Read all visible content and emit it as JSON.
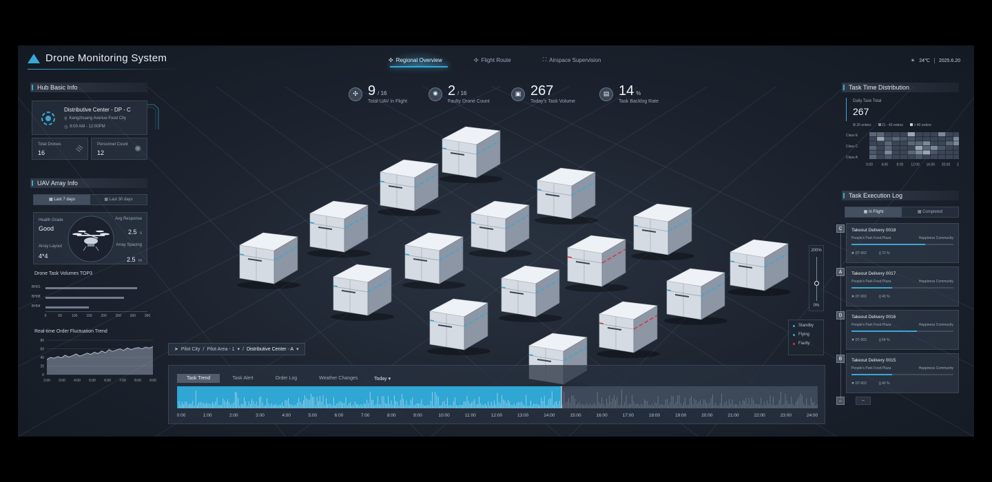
{
  "header": {
    "title": "Drone Monitoring System",
    "nav": [
      {
        "label": "Regional Overview",
        "icon": "drone-icon",
        "active": true
      },
      {
        "label": "Flight Route",
        "icon": "route-icon",
        "active": false
      },
      {
        "label": "Airspace Supervision",
        "icon": "airspace-icon",
        "active": false
      }
    ],
    "temperature": "24℃",
    "date": "2025.6.20"
  },
  "hub_info": {
    "title": "Hub Basic Info",
    "name": "Distributive Center - DP - C",
    "address": "Kangzhuang Avenue Food City",
    "hours": "8:00 AM - 12:00PM",
    "total_drones_label": "Total Drones",
    "total_drones": "16",
    "personnel_label": "Personnel Count",
    "personnel": "12"
  },
  "uav_array": {
    "title": "UAV Array Info",
    "range_tabs": [
      "Last 7 days",
      "Last 30 days"
    ],
    "health_label": "Health Grade",
    "health": "Good",
    "avg_response_label": "Avg Response",
    "avg_response": "2.5",
    "avg_response_unit": "s",
    "layout_label": "Array Layout",
    "layout": "4*4",
    "spacing_label": "Array Spacing",
    "spacing": "2.5",
    "spacing_unit": "m"
  },
  "top3": {
    "title": "Drone Task Volumes TOP3",
    "rows": [
      {
        "label": "BH01",
        "value": 315
      },
      {
        "label": "BH08",
        "value": 270
      },
      {
        "label": "BH04",
        "value": 150
      }
    ],
    "ticks": [
      "0",
      "50",
      "100",
      "150",
      "200",
      "250",
      "300",
      "350"
    ]
  },
  "trend": {
    "title": "Real-time Order Fluctuation Trend",
    "y_ticks": [
      "0",
      "20",
      "40",
      "60",
      "80"
    ],
    "x_ticks": [
      "2:00",
      "3:00",
      "4:00",
      "5:00",
      "6:00",
      "7:00",
      "8:00",
      "9:00"
    ],
    "values": [
      35,
      40,
      38,
      42,
      39,
      45,
      41,
      44,
      48,
      43,
      46,
      50,
      47,
      52,
      49,
      55,
      51,
      58,
      54,
      57,
      60,
      56,
      62,
      58,
      61,
      63,
      60,
      64,
      62,
      65
    ]
  },
  "stats": [
    {
      "value": "9",
      "total": "16",
      "label": "Total UAV in Flight",
      "icon": "drone-icon"
    },
    {
      "value": "2",
      "total": "16",
      "label": "Faulty Drone Count",
      "icon": "fan-icon"
    },
    {
      "value": "267",
      "total": "",
      "label": "Today's Task Volume",
      "icon": "package-icon"
    },
    {
      "value": "14",
      "total": "%",
      "label": "Task Backlog Rate",
      "icon": "stack-icon"
    }
  ],
  "task_time": {
    "title": "Task Time Distribution",
    "total_label": "Daily Task Total",
    "total": "267",
    "legend": [
      "20 orders",
      "21 - 40 orders",
      "> 40 orders"
    ],
    "rows": [
      "Class E",
      "Class C",
      "Class A"
    ],
    "x_ticks": [
      "0:00",
      "4:00",
      "8:00",
      "12:00",
      "16:00",
      "20:00",
      "24:00"
    ]
  },
  "exec_log": {
    "title": "Task Execution Log",
    "tabs": [
      "In Flight",
      "Completed"
    ],
    "items": [
      {
        "letter": "C",
        "title": "Takeout Delivery 0018",
        "from": "People's Park Food Plaza",
        "to": "Happiness Community",
        "drone": "DT-002",
        "battery": "72 %",
        "progress": 0.72
      },
      {
        "letter": "A",
        "title": "Takeout Delivery 0017",
        "from": "People's Park Food Plaza",
        "to": "Happiness Community",
        "drone": "DT-002",
        "battery": "40 %",
        "progress": 0.4
      },
      {
        "letter": "D",
        "title": "Takeout Delivery 0016",
        "from": "People's Park Food Plaza",
        "to": "Happiness Community",
        "drone": "DT-002",
        "battery": "64 %",
        "progress": 0.64
      },
      {
        "letter": "B",
        "title": "Takeout Delivery 0015",
        "from": "People's Park Food Plaza",
        "to": "Happiness Community",
        "drone": "DT-002",
        "battery": "40 %",
        "progress": 0.4
      }
    ]
  },
  "zoom": {
    "max": "200%",
    "min": "0%",
    "level": 0.4
  },
  "legend": [
    {
      "label": "Standby",
      "color": "#3aa7d6"
    },
    {
      "label": "Flying",
      "color": "#3aa7d6"
    },
    {
      "label": "Faulty",
      "color": "#e0343a"
    }
  ],
  "breadcrumb": {
    "city": "Pilot City",
    "area": "Pilot Area - 1",
    "center": "Distributive Center - A"
  },
  "bottom": {
    "tabs": [
      "Task Trend",
      "Task Alert",
      "Order Log",
      "Weather Changes"
    ],
    "range": "Today",
    "hours": [
      "0:00",
      "1:00",
      "2:00",
      "3:00",
      "4:00",
      "5:00",
      "6:00",
      "7:00",
      "8:00",
      "9:00",
      "10:00",
      "11:00",
      "12:00",
      "13:00",
      "14:00",
      "15:00",
      "16:00",
      "17:00",
      "18:00",
      "19:00",
      "20:00",
      "21:00",
      "22:00",
      "23:00",
      "24:00"
    ],
    "current_fraction": 0.6
  },
  "colors": {
    "accent": "#3aa7d6",
    "fault": "#e0343a"
  }
}
